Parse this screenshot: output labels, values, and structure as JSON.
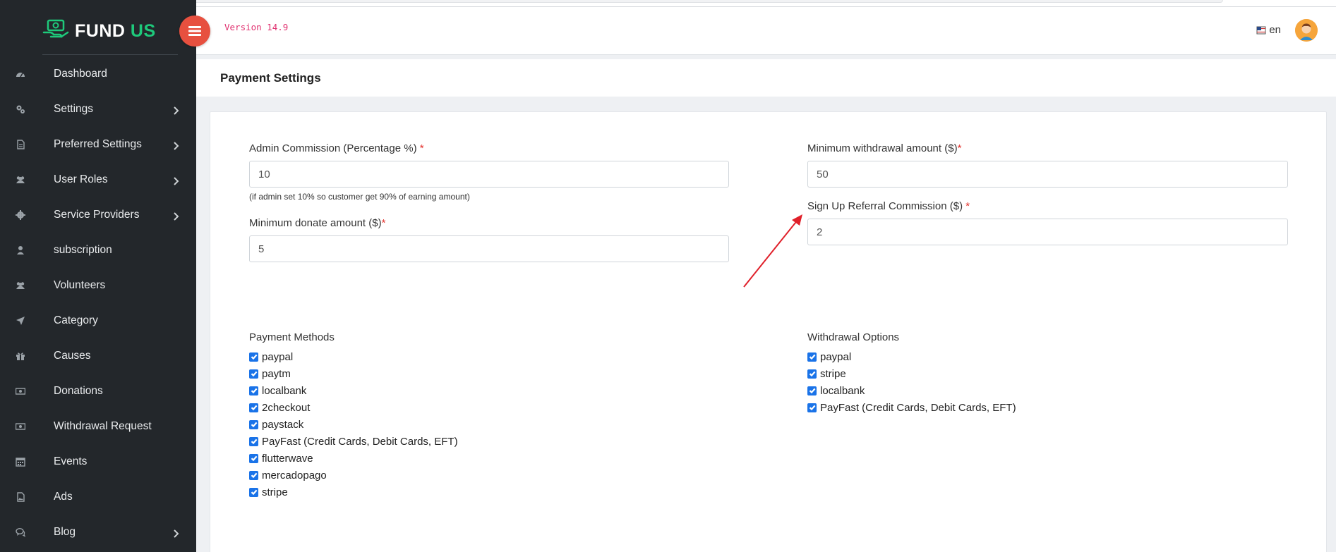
{
  "app": {
    "brand_main": "FUND",
    "brand_accent": "US",
    "version": "Version 14.9",
    "language": "en"
  },
  "colors": {
    "sidebar_bg": "#23272b",
    "brand_accent": "#1ec97b",
    "toggle_button": "#e7503f",
    "version_text": "#e0306f",
    "checkbox": "#1a73e8",
    "required_marker": "#e3342f",
    "annotation_arrow": "#e0202a"
  },
  "sidebar": {
    "items": [
      {
        "label": "Dashboard",
        "icon": "dashboard-icon",
        "has_submenu": false
      },
      {
        "label": "Settings",
        "icon": "gears-icon",
        "has_submenu": true
      },
      {
        "label": "Preferred Settings",
        "icon": "document-icon",
        "has_submenu": true
      },
      {
        "label": "User Roles",
        "icon": "users-icon",
        "has_submenu": true
      },
      {
        "label": "Service Providers",
        "icon": "gear-icon",
        "has_submenu": true
      },
      {
        "label": "subscription",
        "icon": "user-icon",
        "has_submenu": false
      },
      {
        "label": "Volunteers",
        "icon": "users-icon",
        "has_submenu": false
      },
      {
        "label": "Category",
        "icon": "location-arrow-icon",
        "has_submenu": false
      },
      {
        "label": "Causes",
        "icon": "gift-icon",
        "has_submenu": false
      },
      {
        "label": "Donations",
        "icon": "money-icon",
        "has_submenu": false
      },
      {
        "label": "Withdrawal Request",
        "icon": "money-icon",
        "has_submenu": false
      },
      {
        "label": "Events",
        "icon": "calendar-icon",
        "has_submenu": false
      },
      {
        "label": "Ads",
        "icon": "image-file-icon",
        "has_submenu": false
      },
      {
        "label": "Blog",
        "icon": "comments-icon",
        "has_submenu": true
      }
    ]
  },
  "page": {
    "title": "Payment Settings"
  },
  "form": {
    "admin_commission": {
      "label": "Admin Commission (Percentage %)",
      "required": "*",
      "value": "10",
      "help": "(if admin set 10% so customer get 90% of earning amount)"
    },
    "min_donate": {
      "label": "Minimum donate amount ($)",
      "required": "*",
      "value": "5"
    },
    "min_withdrawal": {
      "label": "Minimum withdrawal amount ($)",
      "required": "*",
      "value": "50"
    },
    "signup_referral": {
      "label": "Sign Up Referral Commission ($)",
      "required": "*",
      "value": "2"
    }
  },
  "payment_methods": {
    "title": "Payment Methods",
    "options": [
      {
        "label": "paypal",
        "checked": true
      },
      {
        "label": "paytm",
        "checked": true
      },
      {
        "label": "localbank",
        "checked": true
      },
      {
        "label": "2checkout",
        "checked": true
      },
      {
        "label": "paystack",
        "checked": true
      },
      {
        "label": "PayFast (Credit Cards, Debit Cards, EFT)",
        "checked": true
      },
      {
        "label": "flutterwave",
        "checked": true
      },
      {
        "label": "mercadopago",
        "checked": true
      },
      {
        "label": "stripe",
        "checked": true
      }
    ]
  },
  "withdrawal_options": {
    "title": "Withdrawal Options",
    "options": [
      {
        "label": "paypal",
        "checked": true
      },
      {
        "label": "stripe",
        "checked": true
      },
      {
        "label": "localbank",
        "checked": true
      },
      {
        "label": "PayFast (Credit Cards, Debit Cards, EFT)",
        "checked": true
      }
    ]
  }
}
